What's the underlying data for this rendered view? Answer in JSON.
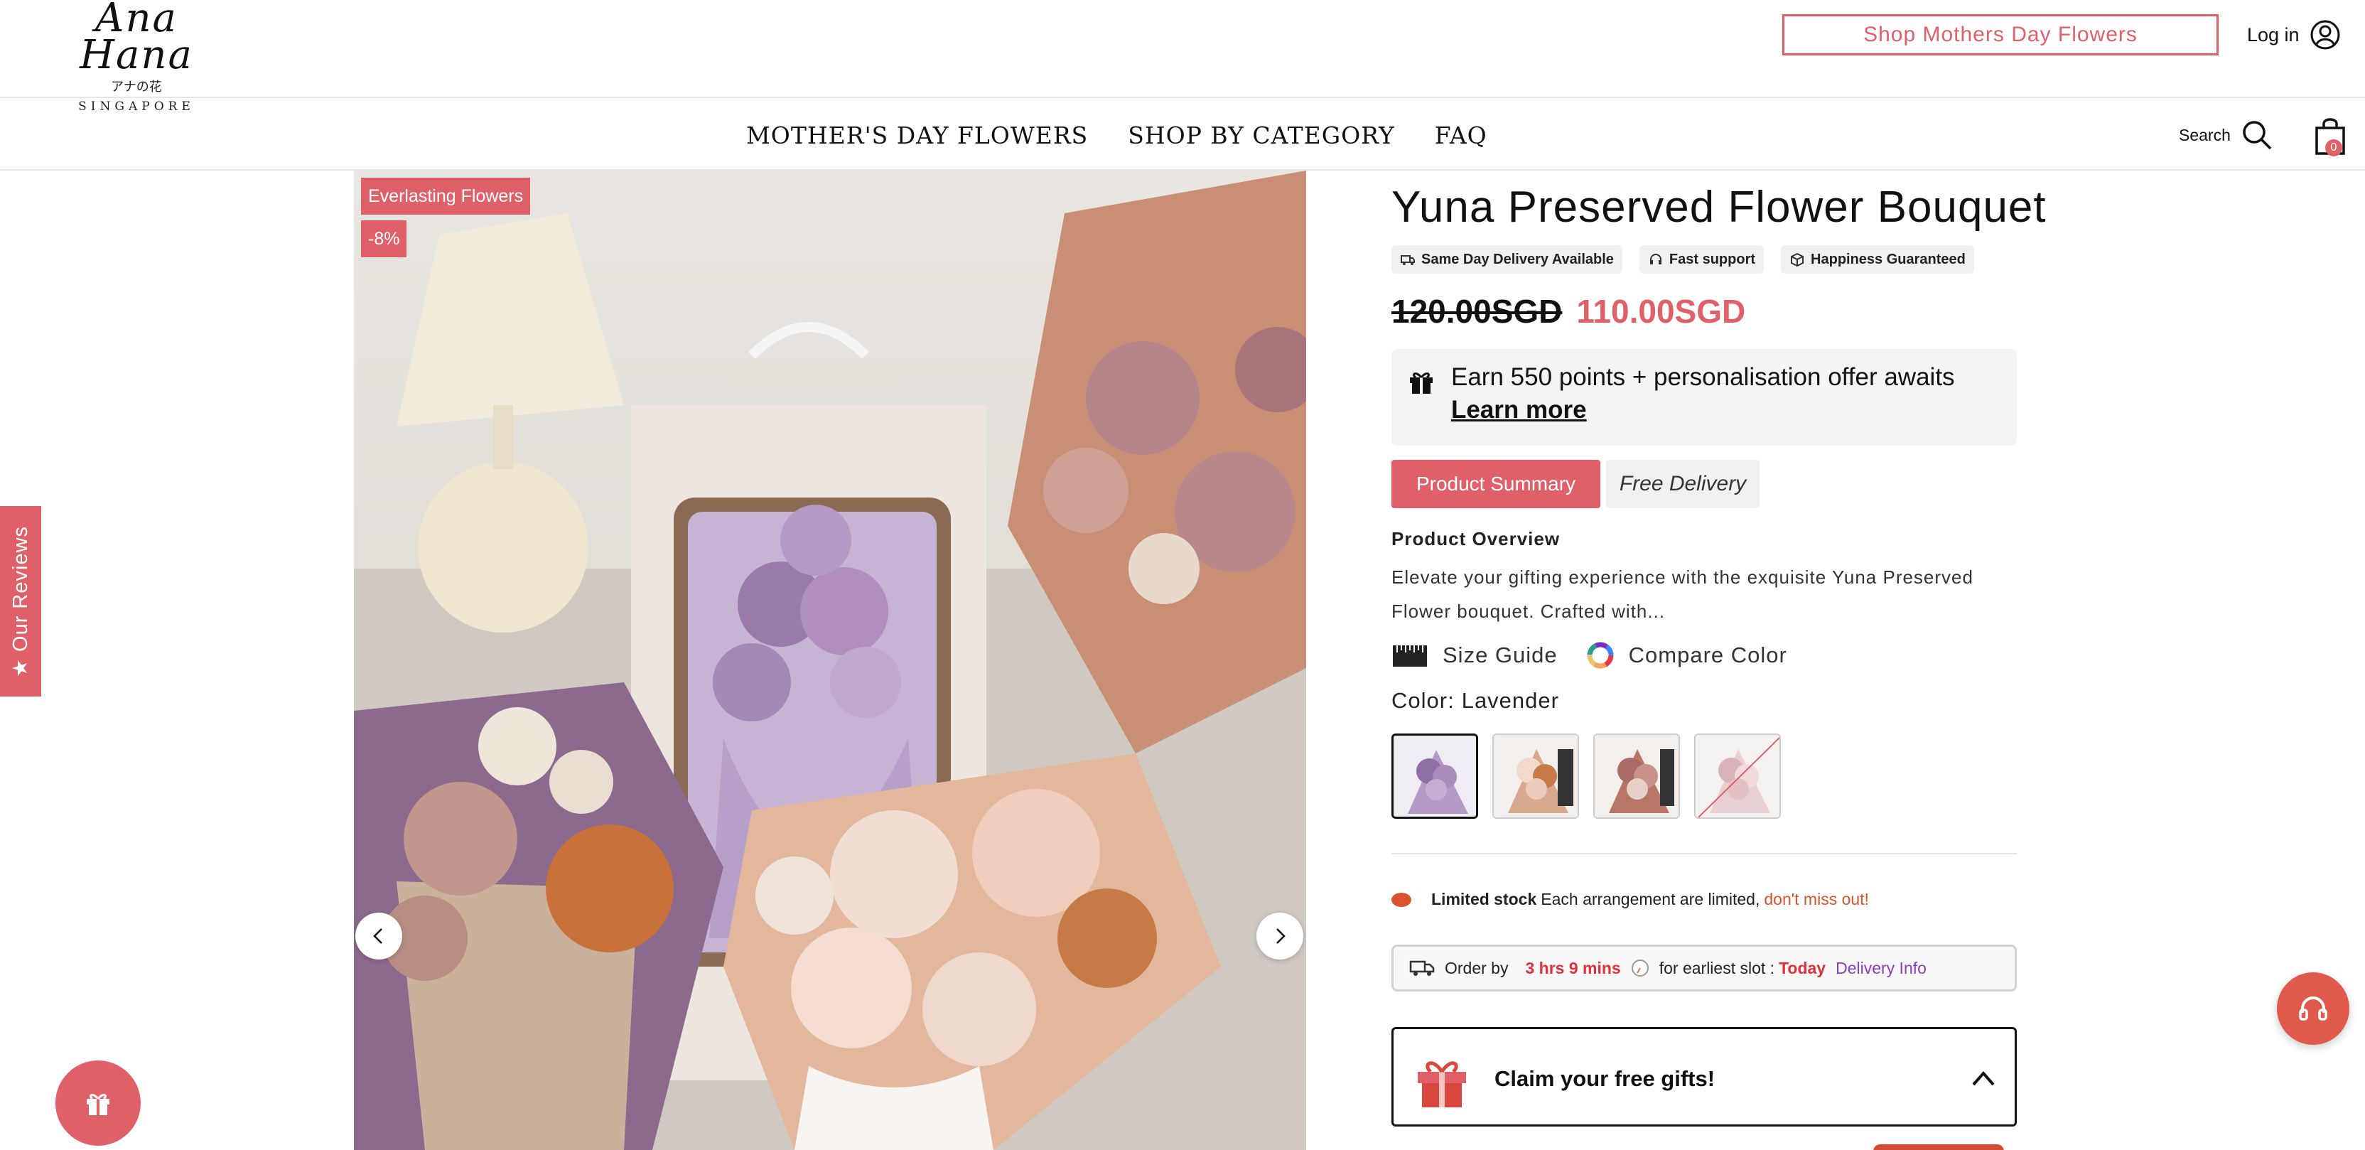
{
  "header": {
    "logo": {
      "script": "Ana Hana",
      "japanese": "アナの花",
      "subtitle": "SINGAPORE"
    },
    "promo_button": "Shop Mothers Day Flowers",
    "login_label": "Log in"
  },
  "nav": {
    "items": [
      "MOTHER'S DAY FLOWERS",
      "SHOP BY CATEGORY",
      "FAQ"
    ],
    "search_label": "Search",
    "cart_count": "0"
  },
  "reviews_tab": {
    "label": "★ Our Reviews"
  },
  "gallery": {
    "collection_tag": "Everlasting Flowers",
    "discount_tag": "-8%"
  },
  "product": {
    "title": "Yuna Preserved Flower Bouquet",
    "badges": [
      "Same Day Delivery Available",
      "Fast support",
      "Happiness Guaranteed"
    ],
    "price_old": "120.00SGD",
    "price_new": "110.00SGD",
    "points_text": "Earn 550 points + personalisation offer awaits",
    "points_link": "Learn more",
    "tabs": [
      "Product Summary",
      "Free Delivery"
    ],
    "overview_title": "Product Overview",
    "overview_text": "Elevate your gifting experience with the exquisite Yuna Preserved Flower bouquet. Crafted with...",
    "size_guide": "Size Guide",
    "compare_color": "Compare Color",
    "color_label": "Color:",
    "color_value": "Lavender",
    "swatches": [
      {
        "name": "Lavender",
        "selected": true,
        "available": true
      },
      {
        "name": "Peach",
        "selected": false,
        "available": true
      },
      {
        "name": "Dusty Pink",
        "selected": false,
        "available": true
      },
      {
        "name": "Blush",
        "selected": false,
        "available": false
      }
    ],
    "stock": {
      "strong": "Limited stock",
      "text": "Each arrangement are limited,",
      "warning": "don't miss out!"
    },
    "order": {
      "prefix": "Order by",
      "time": "3 hrs 9 mins",
      "middle": "for earliest slot :",
      "day": "Today",
      "link": "Delivery Info"
    },
    "gift_claim": "Claim your free gifts!"
  },
  "colors": {
    "accent": "#e0606a",
    "warning": "#d9532f",
    "link_purple": "#8a3fb8"
  }
}
